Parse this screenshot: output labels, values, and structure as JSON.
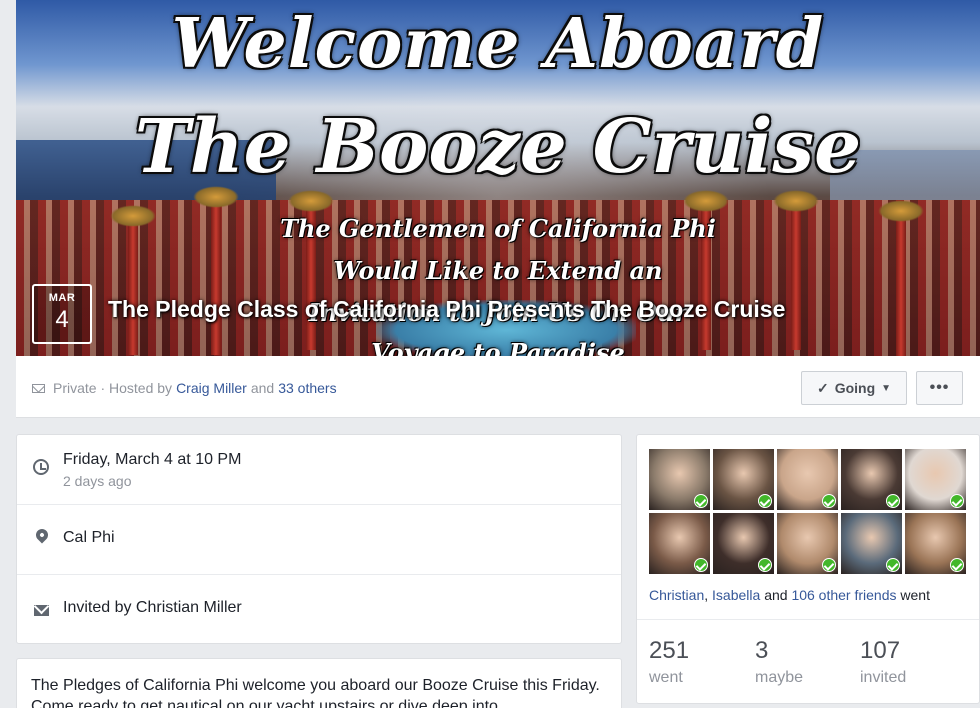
{
  "cover": {
    "headline_line1": "Welcome Aboard",
    "headline_line2": "The Booze Cruise",
    "subtext_line1": "The Gentlemen of California Phi",
    "subtext_line2": "Would Like to Extend an",
    "subtext_line3": "Invitation to Join Us On Our",
    "subtext_line4": "Voyage to Paradise"
  },
  "event": {
    "month": "MAR",
    "day": "4",
    "title": "The Pledge Class of California Phi Presents The Booze Cruise"
  },
  "infobar": {
    "privacy": "Private · Hosted by",
    "host": "Craig Miller",
    "and": "and",
    "others": "33 others",
    "going_label": "Going",
    "more_label": "•••"
  },
  "details": {
    "datetime": "Friday, March 4 at 10 PM",
    "relative": "2 days ago",
    "location": "Cal Phi",
    "invited_by": "Invited by Christian Miller"
  },
  "description": {
    "text": "The Pledges of California Phi welcome you aboard our Booze Cruise this Friday. Come ready to get nautical on our yacht upstairs or dive deep into"
  },
  "attendees": {
    "photos": [
      {
        "color": "#8a7a6a"
      },
      {
        "color": "#6a5444"
      },
      {
        "color": "#c9a58a"
      },
      {
        "color": "#4a3a34"
      },
      {
        "color": "#e0d8d2"
      },
      {
        "color": "#7a5a48"
      },
      {
        "color": "#3e2e2a"
      },
      {
        "color": "#b08a6c"
      },
      {
        "color": "#5a6a7a"
      },
      {
        "color": "#9a7456"
      }
    ],
    "friend1": "Christian",
    "comma": ",",
    "friend2": "Isabella",
    "and": "and",
    "others": "106 other friends",
    "went": "went",
    "stats": [
      {
        "num": "251",
        "label": "went"
      },
      {
        "num": "3",
        "label": "maybe"
      },
      {
        "num": "107",
        "label": "invited"
      }
    ]
  }
}
